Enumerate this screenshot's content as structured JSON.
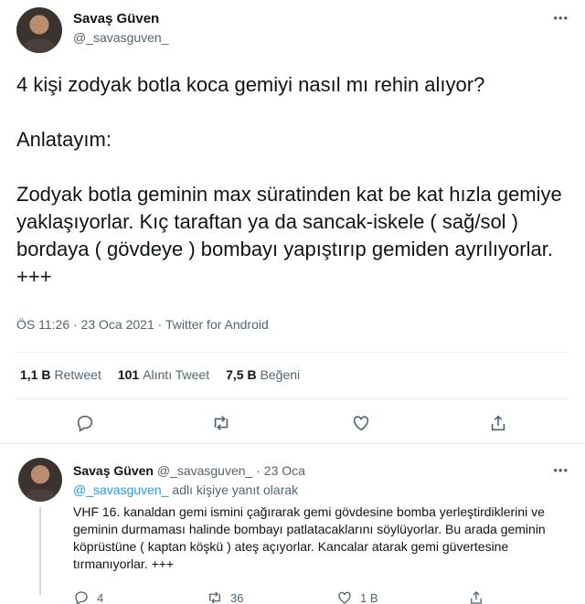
{
  "main_tweet": {
    "author_name": "Savaş Güven",
    "author_handle": "@_savasguven_",
    "text": "4 kişi zodyak botla koca gemiyi nasıl mı rehin alıyor?\n\nAnlatayım:\n\nZodyak botla geminin max süratinden kat be kat hızla gemiye yaklaşıyorlar. Kıç taraftan ya da sancak-iskele ( sağ/sol ) bordaya ( gövdeye ) bombayı yapıştırıp gemiden ayrılıyorlar. +++",
    "timestamp": "ÖS 11:26 · 23 Oca 2021",
    "separator": " · ",
    "source": "Twitter for Android",
    "stats": {
      "retweets_count": "1,1 B",
      "retweets_label": "Retweet",
      "quotes_count": "101",
      "quotes_label": "Alıntı Tweet",
      "likes_count": "7,5 B",
      "likes_label": "Beğeni"
    },
    "more_glyph": "•••"
  },
  "reply_tweet": {
    "author_name": "Savaş Güven",
    "author_handle": "@_savasguven_",
    "date": "· 23 Oca",
    "replying_to_mention": "@_savasguven_",
    "replying_to_suffix": " adlı kişiye yanıt olarak",
    "text": "VHF 16. kanaldan gemi ismini çağırarak gemi gövdesine bomba yerleştirdiklerini ve geminin durmaması halinde bombayı patlatacaklarını söylüyorlar. Bu arada geminin köprüstüne ( kaptan köşkü ) ateş açıyorlar. Kancalar atarak gemi güvertesine tırmanıyorlar. +++",
    "reply_count": "4",
    "retweet_count": "36",
    "like_count": "1 B",
    "more_glyph": "•••"
  },
  "colors": {
    "text_primary": "#0f1419",
    "text_secondary": "#536471",
    "link": "#1d9bf0",
    "divider": "#e6ecf0"
  },
  "icons": [
    "reply-icon",
    "retweet-icon",
    "like-icon",
    "share-icon",
    "more-icon",
    "avatar"
  ]
}
